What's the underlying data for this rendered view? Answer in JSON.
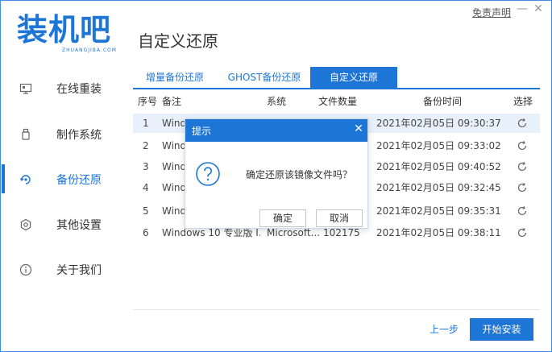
{
  "header": {
    "logo_text": "装机吧",
    "logo_sub": "ZHUANGJIBA.COM",
    "title": "自定义还原",
    "disclaimer": "免责声明",
    "minimize_glyph": "—",
    "close_glyph": "✕"
  },
  "sidebar": {
    "items": [
      {
        "label": "在线重装",
        "icon": "monitor-icon"
      },
      {
        "label": "制作系统",
        "icon": "usb-icon"
      },
      {
        "label": "备份还原",
        "icon": "backup-icon",
        "active": true
      },
      {
        "label": "其他设置",
        "icon": "gear-icon"
      },
      {
        "label": "关于我们",
        "icon": "info-icon"
      }
    ]
  },
  "tabs": [
    {
      "label": "增量备份还原"
    },
    {
      "label": "GHOST备份还原"
    },
    {
      "label": "自定义还原",
      "active": true
    }
  ],
  "table": {
    "headers": [
      "序号",
      "备注",
      "系统",
      "文件数量",
      "备份时间",
      "选择"
    ],
    "rows": [
      {
        "num": "1",
        "note": "Wind",
        "system": "",
        "count": "",
        "time": "2021年02月05日 09:30:37"
      },
      {
        "num": "2",
        "note": "Wind",
        "system": "",
        "count": "",
        "time": "2021年02月05日 09:33:02"
      },
      {
        "num": "3",
        "note": "Wind",
        "system": "",
        "count": "",
        "time": "2021年02月05日 09:40:52"
      },
      {
        "num": "4",
        "note": "Wind",
        "system": "",
        "count": "",
        "time": "2021年02月05日 09:32:45"
      },
      {
        "num": "5",
        "note": "Wind",
        "system": "",
        "count": "",
        "time": "2021年02月05日 09:35:31"
      },
      {
        "num": "6",
        "note": "Windows 10 专业版 I...",
        "system": "Microsoft...",
        "count": "102175",
        "time": "2021年02月05日 09:38:11"
      }
    ],
    "selected_row": 1
  },
  "dialog": {
    "title": "提示",
    "close_glyph": "✕",
    "message": "确定还原该镜像文件吗？",
    "confirm_label": "确定",
    "cancel_label": "取消"
  },
  "footer": {
    "prev_label": "上一步",
    "install_label": "开始安装"
  },
  "colors": {
    "accent": "#1d76d6",
    "selected_row_bg": "#e8f1fb"
  }
}
